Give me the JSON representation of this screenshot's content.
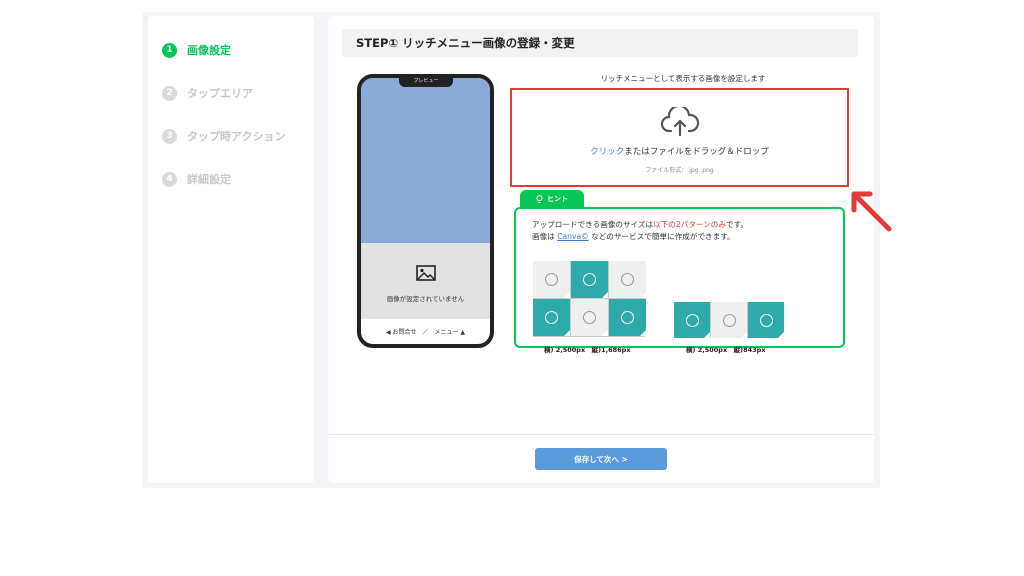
{
  "sidebar": {
    "steps": [
      {
        "num": "1",
        "label": "画像設定"
      },
      {
        "num": "2",
        "label": "タップエリア"
      },
      {
        "num": "3",
        "label": "タップ時アクション"
      },
      {
        "num": "4",
        "label": "詳細設定"
      }
    ]
  },
  "main": {
    "step_title": "STEP① リッチメニュー画像の登録・変更",
    "preview": {
      "notch_label": "プレビュー",
      "no_image_text": "画像が設定されていません",
      "footer_left": "◀ お問合せ",
      "footer_sep": "／",
      "footer_right": "メニュー ▲"
    },
    "upload": {
      "title": "リッチメニューとして表示する画像を設定します",
      "drop_link": "クリック",
      "drop_text": "またはファイルをドラッグ＆ドロップ",
      "format": "ファイル形式：.jpg .png"
    },
    "hint": {
      "tab_label": "ヒント",
      "line1_pre": "アップロードできる画像のサイズは",
      "line1_red": "以下の2パターンのみ",
      "line1_post": "です。",
      "line2_pre": "画像は ",
      "line2_link": "Canva©",
      "line2_post": " などのサービスで簡単に作成ができます。",
      "pattern1_dims": "横) 2,500px　縦)1,686px",
      "pattern2_dims": "横) 2,500px　縦)843px"
    },
    "save_button": "保存して次へ >"
  },
  "colors": {
    "accent_green": "#06c755",
    "dropzone_border": "#e53935",
    "save_button": "#5b9bdc",
    "teal_tile": "#2faaaa"
  }
}
